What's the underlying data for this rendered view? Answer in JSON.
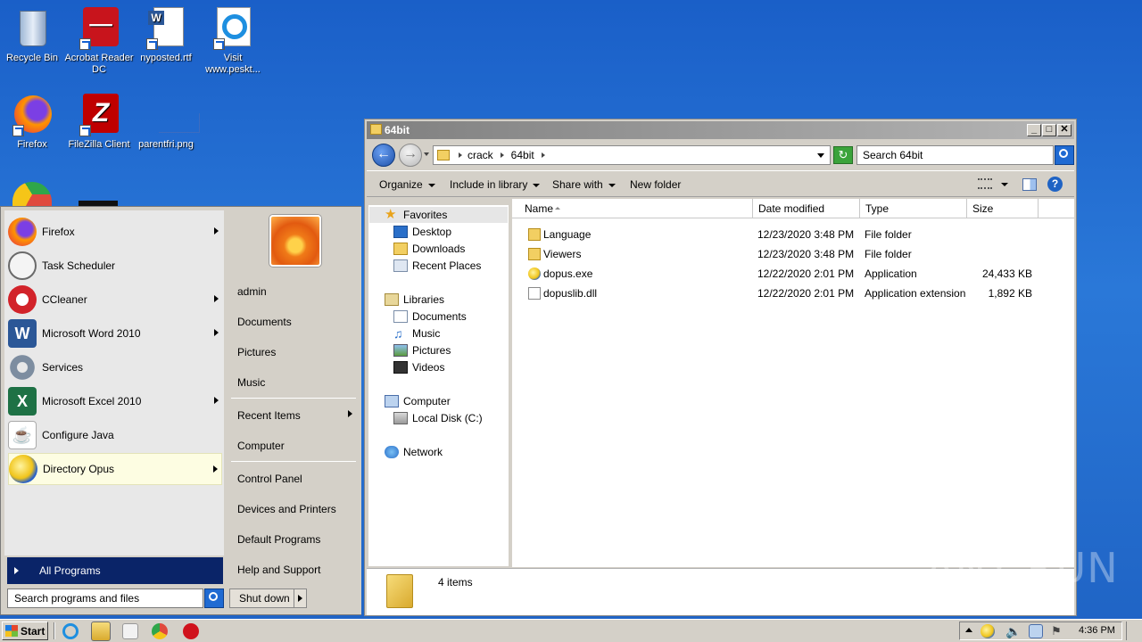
{
  "desktop": {
    "icons": [
      {
        "label": "Recycle Bin",
        "icon": "recycle-bin-icon"
      },
      {
        "label": "Acrobat Reader DC",
        "icon": "acrobat-icon"
      },
      {
        "label": "nyposted.rtf",
        "icon": "word-doc-icon"
      },
      {
        "label": "Visit www.peskt...",
        "icon": "ie-icon"
      },
      {
        "label": "Firefox",
        "icon": "firefox-icon"
      },
      {
        "label": "FileZilla Client",
        "icon": "filezilla-icon"
      },
      {
        "label": "parentfri.png",
        "icon": "image-file-icon"
      }
    ]
  },
  "start_menu": {
    "programs": [
      {
        "label": "Firefox",
        "icon": "firefox-icon",
        "has_submenu": true
      },
      {
        "label": "Task Scheduler",
        "icon": "clock-icon",
        "has_submenu": false
      },
      {
        "label": "CCleaner",
        "icon": "ccleaner-icon",
        "has_submenu": true
      },
      {
        "label": "Microsoft Word 2010",
        "icon": "word-icon",
        "has_submenu": true
      },
      {
        "label": "Services",
        "icon": "gears-icon",
        "has_submenu": false
      },
      {
        "label": "Microsoft Excel 2010",
        "icon": "excel-icon",
        "has_submenu": true
      },
      {
        "label": "Configure Java",
        "icon": "java-icon",
        "has_submenu": false
      },
      {
        "label": "Directory Opus",
        "icon": "dopus-icon",
        "has_submenu": true,
        "highlighted": true
      }
    ],
    "all_programs": "All Programs",
    "search_placeholder": "Search programs and files",
    "right": {
      "user": "admin",
      "documents": "Documents",
      "pictures": "Pictures",
      "music": "Music",
      "recent_items": "Recent Items",
      "computer": "Computer",
      "control_panel": "Control Panel",
      "devices_printers": "Devices and Printers",
      "default_programs": "Default Programs",
      "help_support": "Help and Support"
    },
    "shutdown": "Shut down"
  },
  "explorer": {
    "title": "64bit",
    "breadcrumb": [
      "crack",
      "64bit"
    ],
    "search_placeholder": "Search 64bit",
    "toolbar": {
      "organize": "Organize",
      "include_library": "Include in library",
      "share_with": "Share with",
      "new_folder": "New folder"
    },
    "nav": {
      "favorites": "Favorites",
      "desktop": "Desktop",
      "downloads": "Downloads",
      "recent_places": "Recent Places",
      "libraries": "Libraries",
      "documents": "Documents",
      "music": "Music",
      "pictures": "Pictures",
      "videos": "Videos",
      "computer": "Computer",
      "local_disk": "Local Disk (C:)",
      "network": "Network"
    },
    "columns": {
      "name": "Name",
      "date": "Date modified",
      "type": "Type",
      "size": "Size"
    },
    "files": [
      {
        "name": "Language",
        "date": "12/23/2020 3:48 PM",
        "type": "File folder",
        "size": "",
        "icon": "folder-icon"
      },
      {
        "name": "Viewers",
        "date": "12/23/2020 3:48 PM",
        "type": "File folder",
        "size": "",
        "icon": "folder-icon"
      },
      {
        "name": "dopus.exe",
        "date": "12/22/2020 2:01 PM",
        "type": "Application",
        "size": "24,433 KB",
        "icon": "dopus-exe-icon"
      },
      {
        "name": "dopuslib.dll",
        "date": "12/22/2020 2:01 PM",
        "type": "Application extension",
        "size": "1,892 KB",
        "icon": "dll-icon"
      }
    ],
    "status": "4 items"
  },
  "taskbar": {
    "start": "Start",
    "clock": "4:36 PM"
  },
  "watermark": "ANY RUN",
  "colors": {
    "accent": "#0a2468",
    "desktop": "#2a78d8",
    "highlight": "#fdfde2"
  }
}
